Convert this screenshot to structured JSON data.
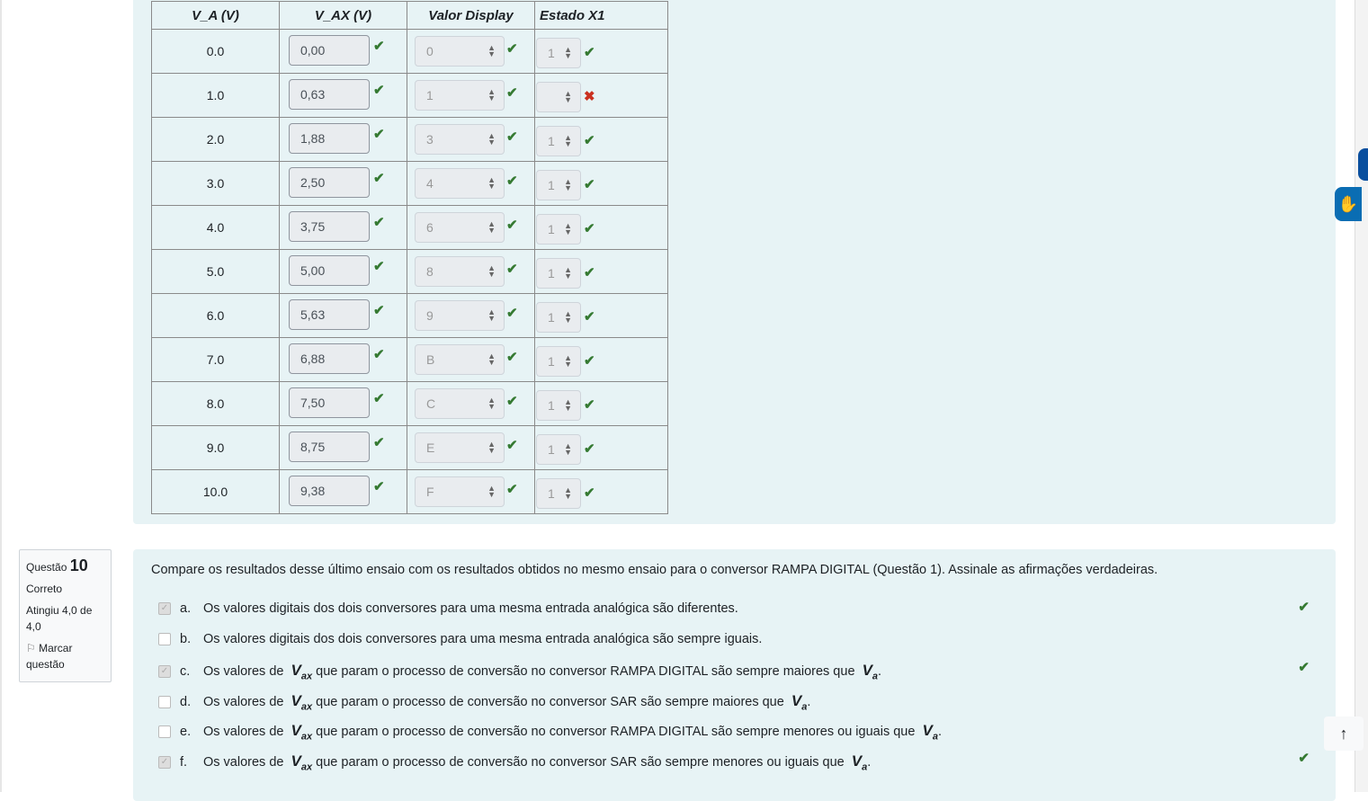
{
  "table": {
    "headers": [
      "V_A (V)",
      "V_AX (V)",
      "Valor Display",
      "Estado X1"
    ],
    "rows": [
      {
        "va": "0.0",
        "vax": "0,00",
        "display": "0",
        "estado": "1",
        "estado_ok": true
      },
      {
        "va": "1.0",
        "vax": "0,63",
        "display": "1",
        "estado": "",
        "estado_ok": false
      },
      {
        "va": "2.0",
        "vax": "1,88",
        "display": "3",
        "estado": "1",
        "estado_ok": true
      },
      {
        "va": "3.0",
        "vax": "2,50",
        "display": "4",
        "estado": "1",
        "estado_ok": true
      },
      {
        "va": "4.0",
        "vax": "3,75",
        "display": "6",
        "estado": "1",
        "estado_ok": true
      },
      {
        "va": "5.0",
        "vax": "5,00",
        "display": "8",
        "estado": "1",
        "estado_ok": true
      },
      {
        "va": "6.0",
        "vax": "5,63",
        "display": "9",
        "estado": "1",
        "estado_ok": true
      },
      {
        "va": "7.0",
        "vax": "6,88",
        "display": "B",
        "estado": "1",
        "estado_ok": true
      },
      {
        "va": "8.0",
        "vax": "7,50",
        "display": "C",
        "estado": "1",
        "estado_ok": true
      },
      {
        "va": "9.0",
        "vax": "8,75",
        "display": "E",
        "estado": "1",
        "estado_ok": true
      },
      {
        "va": "10.0",
        "vax": "9,38",
        "display": "F",
        "estado": "1",
        "estado_ok": true
      }
    ]
  },
  "question": {
    "label": "Questão",
    "number": "10",
    "status": "Correto",
    "grade": "Atingiu 4,0 de 4,0",
    "flag": "Marcar questão",
    "text": "Compare os resultados desse último ensaio com os resultados obtidos no mesmo ensaio para o conversor RAMPA DIGITAL (Questão 1). Assinale as afirmações verdadeiras.",
    "options": [
      {
        "letter": "a.",
        "pre": "Os valores digitais dos dois conversores para uma mesma entrada analógica são diferentes.",
        "checked": true
      },
      {
        "letter": "b.",
        "pre": "Os valores digitais dos dois conversores para uma mesma entrada analógica são sempre iguais.",
        "checked": false
      },
      {
        "letter": "c.",
        "pre": "Os valores de ",
        "post": " que param o processo de conversão no conversor RAMPA DIGITAL são sempre maiores que ",
        "checked": true
      },
      {
        "letter": "d.",
        "pre": "Os valores de ",
        "post": " que param o processo de conversão no conversor SAR são sempre maiores que ",
        "checked": false
      },
      {
        "letter": "e.",
        "pre": "Os valores de ",
        "post": " que param o processo de conversão no conversor RAMPA DIGITAL são sempre menores ou iguais que ",
        "checked": false
      },
      {
        "letter": "f.",
        "pre": "Os valores de ",
        "post": " que param o processo de conversão no conversor SAR são sempre menores ou iguais que ",
        "checked": true
      }
    ]
  }
}
